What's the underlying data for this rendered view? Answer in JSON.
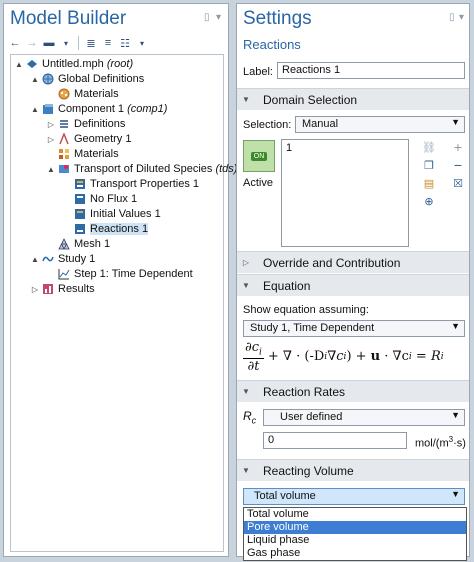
{
  "model_builder": {
    "title": "Model Builder",
    "tree": [
      {
        "label": "Untitled.mph",
        "suffix": "(root)",
        "toggle": "▲",
        "icon": "root-icon"
      },
      {
        "label": "Global Definitions",
        "suffix": "",
        "toggle": "▲",
        "icon": "globe-icon"
      },
      {
        "label": "Materials",
        "suffix": "",
        "toggle": "",
        "icon": "materials-icon"
      },
      {
        "label": "Component 1",
        "suffix": "(comp1)",
        "toggle": "▲",
        "icon": "component-icon"
      },
      {
        "label": "Definitions",
        "suffix": "",
        "toggle": "▷",
        "icon": "definitions-icon"
      },
      {
        "label": "Geometry 1",
        "suffix": "",
        "toggle": "▷",
        "icon": "geometry-icon"
      },
      {
        "label": "Materials",
        "suffix": "",
        "toggle": "",
        "icon": "materials-icon"
      },
      {
        "label": "Transport of Diluted Species",
        "suffix": "(tds)",
        "toggle": "▲",
        "icon": "physics-icon"
      },
      {
        "label": "Transport Properties 1",
        "suffix": "",
        "toggle": "",
        "icon": "feature-icon"
      },
      {
        "label": "No Flux 1",
        "suffix": "",
        "toggle": "",
        "icon": "feature-icon"
      },
      {
        "label": "Initial Values 1",
        "suffix": "",
        "toggle": "",
        "icon": "feature-icon"
      },
      {
        "label": "Reactions 1",
        "suffix": "",
        "toggle": "",
        "icon": "feature-icon"
      },
      {
        "label": "Mesh 1",
        "suffix": "",
        "toggle": "",
        "icon": "mesh-icon"
      },
      {
        "label": "Study 1",
        "suffix": "",
        "toggle": "▲",
        "icon": "study-icon"
      },
      {
        "label": "Step 1: Time Dependent",
        "suffix": "",
        "toggle": "",
        "icon": "step-icon"
      },
      {
        "label": "Results",
        "suffix": "",
        "toggle": "▷",
        "icon": "results-icon"
      }
    ]
  },
  "settings": {
    "title": "Settings",
    "subtitle": "Reactions",
    "label_caption": "Label:",
    "label_value": "Reactions 1",
    "domain_selection": {
      "header": "Domain Selection",
      "selection_caption": "Selection:",
      "selection_value": "Manual",
      "list_item": "1",
      "active_toggle": "ON",
      "active_label": "Active"
    },
    "override": {
      "header": "Override and Contribution"
    },
    "equation": {
      "header": "Equation",
      "assume_caption": "Show equation assuming:",
      "assume_value": "Study 1, Time Dependent",
      "num": "∂c",
      "num_sub": "i",
      "den": "∂t",
      "rest": "+ ∇ · (-D",
      "rest2": "∇c",
      "rest3": ") + ",
      "u": "u",
      "rest4": " · ∇c",
      "rest5": " = R",
      "sub_i": "i"
    },
    "reaction_rates": {
      "header": "Reaction Rates",
      "rc_symbol": "R",
      "rc_sub": "c",
      "rc_value": "User defined",
      "value": "0",
      "unit": "mol/(m",
      "unit_exp": "3",
      "unit_tail": "·s)"
    },
    "reacting_volume": {
      "header": "Reacting Volume",
      "selected": "Total volume",
      "options": [
        "Total volume",
        "Pore volume",
        "Liquid phase",
        "Gas phase"
      ],
      "highlighted_index": 1
    }
  },
  "colors": {
    "accent": "#2a66a5",
    "highlight": "#3d7ed3",
    "section": "#e5e9ee"
  }
}
